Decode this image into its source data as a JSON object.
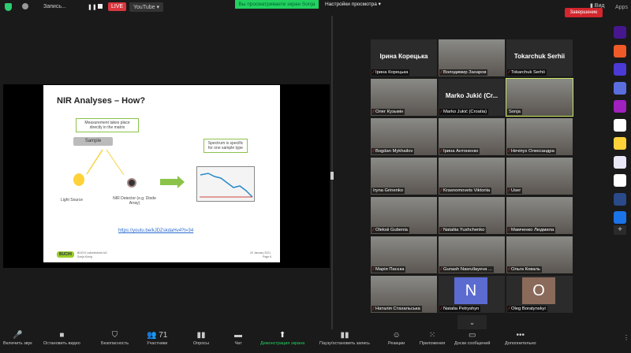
{
  "topbar": {
    "recording": "Запись...",
    "live": "LIVE",
    "stream": "YouTube ▾",
    "viewing": "Вы просматриваете экран Sonja",
    "view_settings": "Настройки просмотра  ▾",
    "view": "Вид",
    "apps": "Apps"
  },
  "slide": {
    "title": "NIR Analyses – How?",
    "box1": "Measurement takes place directly in the matrix",
    "sample": "Sample",
    "box2": "Spectrum is specific for one sample type",
    "light": "Light Source",
    "detector": "NIR Detector (e.g. Diode Array)",
    "link": "https://youtu.be/kJDZskdaHv4?t=34",
    "company": "BÜCHI Labortechnik AG",
    "author": "Sonja König",
    "logo": "BUCHI",
    "date": "20 January 2021",
    "page": "Page 6"
  },
  "participants": [
    {
      "name": "Ірина Корецька",
      "big": "Ірина Корецька"
    },
    {
      "name": "Володимир Захаров",
      "video": true
    },
    {
      "name": "Tokarchuk Serhii",
      "big": "Tokarchuk Serhii"
    },
    {
      "name": "Олег Кузьмін",
      "video": true
    },
    {
      "name": "Marko Jukić (Croatia)",
      "big": "Marko Jukić (Cr..."
    },
    {
      "name": "Sonja",
      "video": true,
      "active": true,
      "nomic": true
    },
    {
      "name": "Bogdan Mykhailov",
      "video": true
    },
    {
      "name": "Ірина Антоненко",
      "video": true
    },
    {
      "name": "Нечiпух Олександра",
      "video": true
    },
    {
      "name": "Iryna Grinenko",
      "video": true,
      "nomic": true
    },
    {
      "name": "Krasnomovets Viktoriia",
      "video": true
    },
    {
      "name": "User",
      "video": true
    },
    {
      "name": "Oleksii Gubenia",
      "video": true
    },
    {
      "name": "Nataliia Yushchenko",
      "video": true
    },
    {
      "name": "Мамченко Людмила",
      "video": true
    },
    {
      "name": "Марія Пасєка",
      "video": true
    },
    {
      "name": "Gunash Nasrullayeva ...",
      "video": true
    },
    {
      "name": "Ольга Коваль",
      "video": true
    },
    {
      "name": "Наталія Стахальська",
      "video": true
    },
    {
      "name": "Natalia Petryshyn",
      "avatar": "N",
      "color": "#5b6bd0"
    },
    {
      "name": "Oleg Boratynskyi",
      "avatar": "O",
      "color": "#8a6a5a"
    }
  ],
  "apps": [
    {
      "name": "kahoot",
      "color": "#46178f"
    },
    {
      "name": "app-orange",
      "color": "#f05a28"
    },
    {
      "name": "wooclap",
      "color": "#4b3ad6"
    },
    {
      "name": "app-face",
      "color": "#5a6ee0"
    },
    {
      "name": "app-stripes",
      "color": "#a020c0"
    },
    {
      "name": "sesh",
      "color": "#ffffff"
    },
    {
      "name": "app-smile",
      "color": "#ffd23a"
    },
    {
      "name": "twine",
      "color": "#e8e8f8"
    },
    {
      "name": "app-grid",
      "color": "#ffffff"
    },
    {
      "name": "app-sync",
      "color": "#2a4a8a"
    },
    {
      "name": "app-blue",
      "color": "#1a73e8"
    }
  ],
  "toolbar": [
    {
      "label": "Включить звук",
      "icon": "🎤"
    },
    {
      "label": "Остановить видео",
      "icon": "■"
    },
    {
      "label": "Безопасность",
      "icon": "⛉"
    },
    {
      "label": "Участники",
      "icon": "👥 71"
    },
    {
      "label": "Опросы",
      "icon": "▮▮"
    },
    {
      "label": "Чат",
      "icon": "▬"
    },
    {
      "label": "Демонстрация экрана",
      "icon": "⬆"
    },
    {
      "label": "Паузу/остановить запись",
      "icon": "▮▮"
    },
    {
      "label": "Реакции",
      "icon": "☺"
    },
    {
      "label": "Приложения",
      "icon": "⁙"
    },
    {
      "label": "Доски сообщений",
      "icon": "▭"
    },
    {
      "label": "Дополнительно",
      "icon": "•••"
    }
  ],
  "end": "Завершение"
}
